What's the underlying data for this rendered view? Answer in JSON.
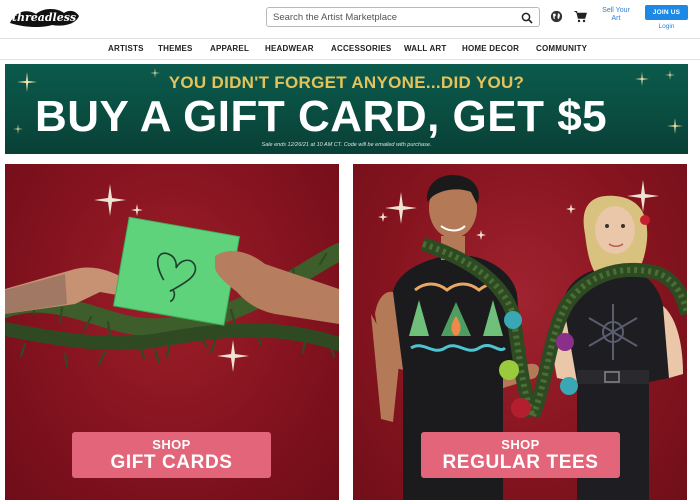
{
  "header": {
    "logo_text": "threadless",
    "search_placeholder": "Search the Artist Marketplace",
    "sell_label": "Sell Your Art",
    "join_label": "JOIN US",
    "login_label": "Login"
  },
  "nav": {
    "items": [
      "ARTISTS",
      "THEMES",
      "APPAREL",
      "HEADWEAR",
      "ACCESSORIES",
      "WALL ART",
      "HOME DECOR",
      "COMMUNITY"
    ]
  },
  "banner": {
    "headline_top": "YOU DIDN'T FORGET ANYONE...DID YOU?",
    "headline_main": "BUY A GIFT CARD, GET $5",
    "fine_print": "Sale ends 12/26/21 at 10 AM CT. Code will be emailed with purchase."
  },
  "tiles": [
    {
      "shop_label": "SHOP",
      "title": "GIFT CARDS"
    },
    {
      "shop_label": "SHOP",
      "title": "REGULAR TEES"
    }
  ],
  "colors": {
    "banner_bg": "#0a4d41",
    "banner_gold": "#e4c35a",
    "tile_bg": "#86141f",
    "button_pink": "#e2657a",
    "join_blue": "#1e88e5",
    "link_blue": "#2e7fd1"
  }
}
